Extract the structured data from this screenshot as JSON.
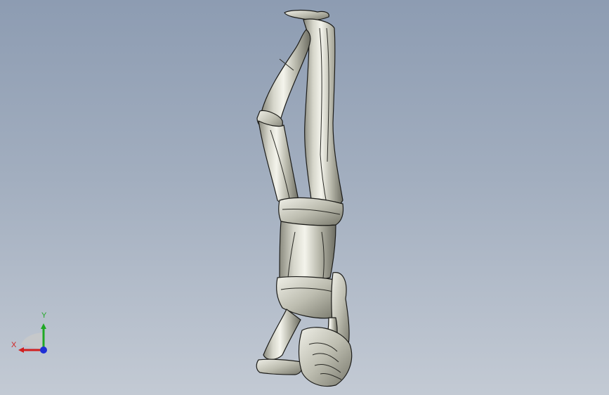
{
  "viewport": {
    "background_top": "#8d9cb2",
    "background_bottom": "#c3cad4",
    "model": {
      "material_light": "#eeeee6",
      "material_mid": "#c8c8bb",
      "material_dark": "#6f6f63",
      "edge_color": "#1b1b18"
    }
  },
  "triad": {
    "x_label": "X",
    "y_label": "Y",
    "x_color": "#d11f1f",
    "y_color": "#1fa824",
    "z_color": "#1e2fd6"
  }
}
